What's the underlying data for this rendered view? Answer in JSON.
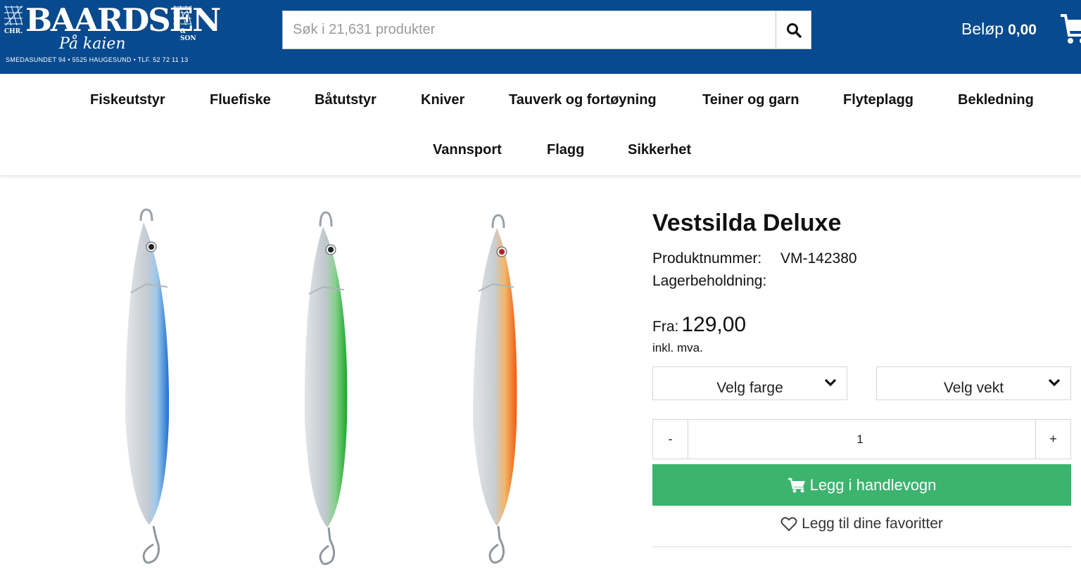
{
  "header": {
    "logo": {
      "main": "BAARDSEN",
      "left": "CHR.",
      "right": "& SON",
      "script": "På kaien",
      "address": "SMEDASUNDET 94 • 5525 HAUGESUND • TLF. 52 72 11 13"
    },
    "search": {
      "placeholder": "Søk i 21,631 produkter",
      "value": ""
    },
    "search_icon": "search-icon",
    "cart": {
      "label": "Beløp",
      "amount": "0,00",
      "icon": "cart-icon"
    },
    "colors": {
      "bar": "#074a8f"
    }
  },
  "nav": {
    "row1": [
      "Fiskeutstyr",
      "Fluefiske",
      "Båtutstyr",
      "Kniver",
      "Tauverk og fortøyning",
      "Teiner og garn",
      "Flyteplagg",
      "Bekledning"
    ],
    "row2": [
      "Vannsport",
      "Flagg",
      "Sikkerhet"
    ]
  },
  "product": {
    "title": "Vestsilda Deluxe",
    "product_number_label": "Produktnummer:",
    "product_number": "VM-142380",
    "stock_label": "Lagerbeholdning:",
    "price_from_label": "Fra:",
    "price": "129,00",
    "vat_note": "inkl. mva.",
    "select_color": "Velg farge",
    "select_weight": "Velg vekt",
    "qty_minus": "-",
    "qty_value": "1",
    "qty_plus": "+",
    "add_to_cart": "Legg i handlevogn",
    "add_favorite": "Legg til dine favoritter",
    "image_colors": [
      "#1f6fd1",
      "#1aa62a",
      "#f05a10"
    ],
    "colors": {
      "button": "#3cb46e"
    }
  }
}
